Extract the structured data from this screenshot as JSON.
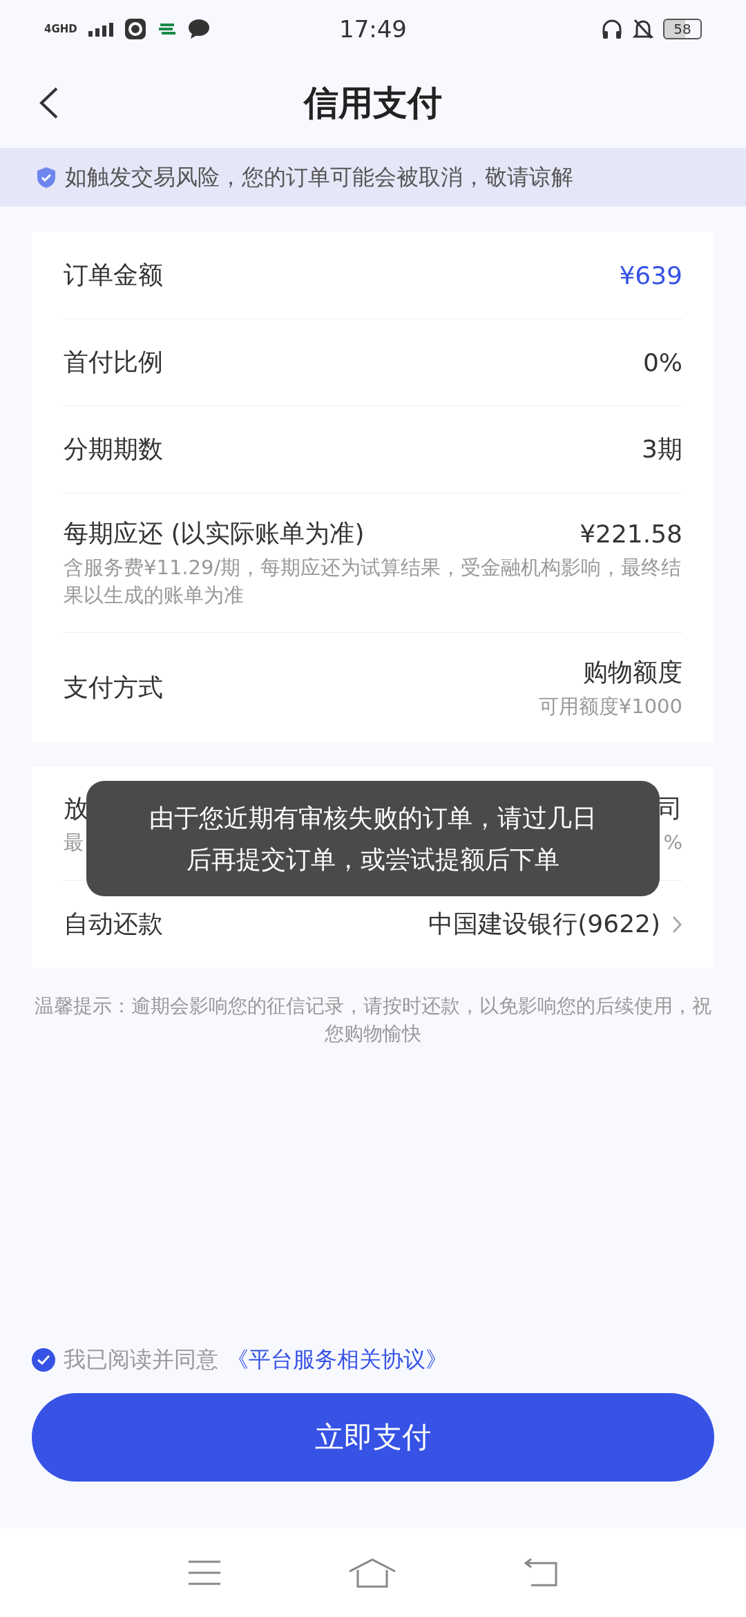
{
  "status_bar": {
    "network": "4GHD",
    "time": "17:49",
    "battery": "58"
  },
  "header": {
    "title": "信用支付"
  },
  "notice": "如触发交易风险，您的订单可能会被取消，敬请谅解",
  "order_card": {
    "rows": [
      {
        "label": "订单金额",
        "value": "¥639",
        "highlighted": true
      },
      {
        "label": "首付比例",
        "value": "0%",
        "highlighted": false
      },
      {
        "label": "分期期数",
        "value": "3期",
        "highlighted": false
      },
      {
        "label": "每期应还 (以实际账单为准)",
        "value": "¥221.58",
        "highlighted": false,
        "note": "含服务费¥11.29/期，每期应还为试算结果，受金融机构影响，最终结果以生成的账单为准"
      },
      {
        "label": "支付方式",
        "value": "购物额度",
        "highlighted": false,
        "value_note": "可用额度¥1000"
      }
    ]
  },
  "lender_card": {
    "rows": [
      {
        "label": "放",
        "value": "司",
        "note": "最",
        "value_note": "%",
        "chevron": false
      },
      {
        "label": "自动还款",
        "value": "中国建设银行(9622)",
        "chevron": true
      }
    ]
  },
  "tip": "温馨提示：逾期会影响您的征信记录，请按时还款，以免影响您的后续使用，祝您购物愉快",
  "agreement": {
    "checked": true,
    "text": "我已阅读并同意",
    "link": "《平台服务相关协议》"
  },
  "pay_button": "立即支付",
  "toast": "由于您近期有审核失败的订单，请过几日后再提交订单，或尝试提额后下单"
}
